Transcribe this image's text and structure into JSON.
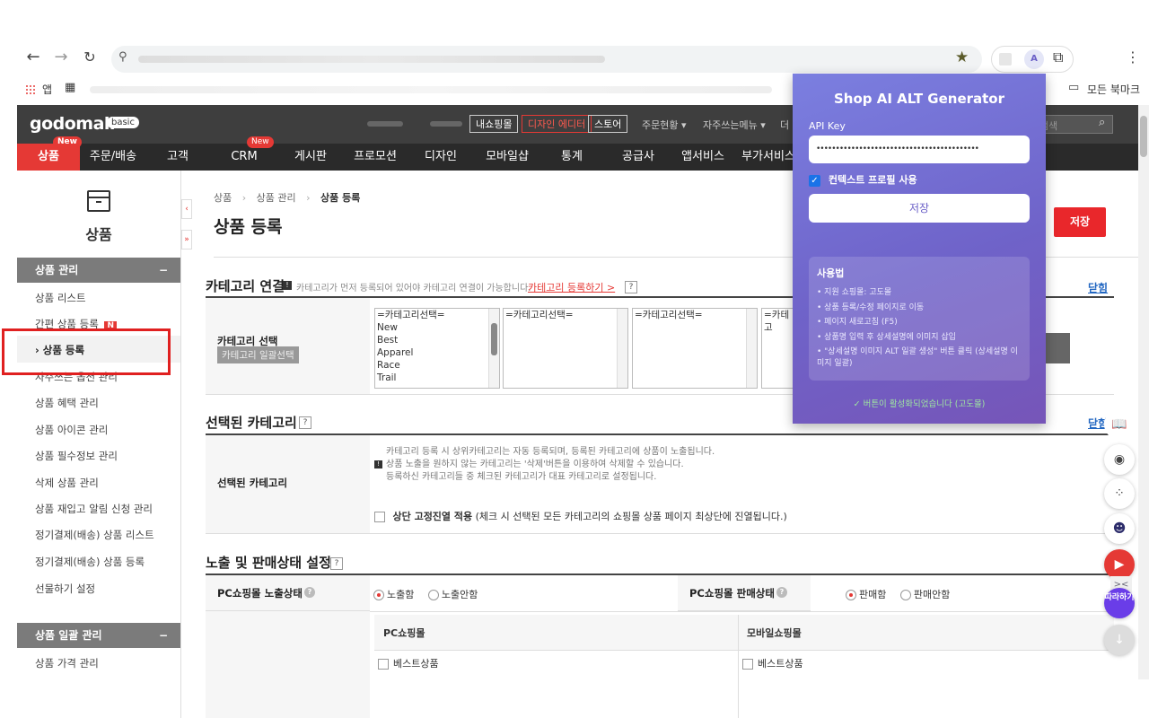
{
  "browser": {
    "apps_label": "앱",
    "bookmarks_label": "모든 북마크",
    "extension_avatar": "A"
  },
  "site": {
    "logo": "godomall",
    "logo_badge": "basic",
    "top_buttons": [
      "내쇼핑몰",
      "디자인 에디터",
      "스토어"
    ],
    "top_menus": [
      "주문현황 ▾",
      "자주쓰는메뉴 ▾",
      "더"
    ],
    "search_placeholder": "검색",
    "nav": [
      "상품",
      "주문/배송",
      "고객",
      "CRM",
      "게시판",
      "프로모션",
      "디자인",
      "모바일샵",
      "통계",
      "공급사",
      "앱서비스",
      "부가서비스"
    ],
    "new_tag": "New"
  },
  "sidebar": {
    "title": "상품",
    "group1": "상품 관리",
    "group1_toggle": "−",
    "items": [
      "상품 리스트",
      "간편 상품 등록",
      "› 상품 등록",
      "자주쓰는 옵션 관리",
      "상품 혜택 관리",
      "상품 아이콘 관리",
      "상품 필수정보 관리",
      "삭제 상품 관리",
      "상품 재입고 알림 신청 관리",
      "정기결제(배송) 상품 리스트",
      "정기결제(배송) 상품 등록",
      "선물하기 설정"
    ],
    "n_badge": "N",
    "group2": "상품 일괄 관리",
    "group2_toggle": "−",
    "items2": [
      "상품 가격 관리"
    ]
  },
  "page": {
    "breadcrumb": [
      "상품",
      "상품 관리",
      "상품 등록"
    ],
    "title": "상품 등록",
    "save_button": "저장",
    "section1": {
      "title": "카테고리 연결",
      "note": "카테고리가 먼저 등록되어 있어야 카테고리 연결이 가능합니다.",
      "link": "카테고리 등록하기 >",
      "fold": "닫힘",
      "row_label": "카테고리 선택",
      "bulk_button": "카테고리 일괄선택",
      "list1": [
        "=카테고리선택=",
        "New",
        "Best",
        "Apparel",
        "Race",
        "Trail"
      ],
      "list2": [
        "=카테고리선택="
      ],
      "list3": [
        "=카테고리선택="
      ],
      "list4": [
        "=카테고"
      ]
    },
    "section2": {
      "title": "선택된 카테고리",
      "fold": "닫힘",
      "row_label": "선택된 카테고리",
      "notes": [
        "카테고리 등록 시 상위카테고리는 자동 등록되며, 등록된 카테고리에 상품이 노출됩니다.",
        "상품 노출을 원하지 않는 카테고리는 '삭제'버튼을 이용하여 삭제할 수 있습니다.",
        "등록하신 카테고리들 중 체크된 카테고리가 대표 카테고리로 설정됩니다."
      ],
      "fixed_label": "상단 고정진열 적용",
      "fixed_desc": "(체크 시 선택된 모든 카테고리의 쇼핑몰 상품 페이지 최상단에 진열됩니다.)"
    },
    "section3": {
      "title": "노출 및 판매상태 설정",
      "pc_display_label": "PC쇼핑몰 노출상태",
      "display_on": "노출함",
      "display_off": "노출안함",
      "pc_sale_label": "PC쇼핑몰 판매상태",
      "sale_on": "판매함",
      "sale_off": "판매안함",
      "col_pc": "PC쇼핑몰",
      "col_mobile": "모바일쇼핑몰",
      "best_pc": "베스트상품",
      "best_mobile": "베스트상품"
    }
  },
  "popup": {
    "title": "Shop AI ALT Generator",
    "api_key_label": "API Key",
    "api_key_value": "••••••••••••••••••••••••••••••••••••••••••",
    "context_label": "컨텍스트 프로필 사용",
    "save_button": "저장",
    "usage_title": "사용법",
    "usage_items": [
      "• 지원 쇼핑몰: 고도몰",
      "• 상품 등록/수정 페이지로 이동",
      "• 페이지 새로고침 (F5)",
      "• 상품명 입력 후 상세설명에 이미지 삽입",
      "• \"상세설명 이미지 ALT 일괄 생성\" 버튼 클릭 (상세설명 이미지 일괄)"
    ],
    "status": "✓ 버튼이 활성화되었습니다 (고도몰)"
  },
  "float": {
    "follow_label": "따라하기"
  }
}
